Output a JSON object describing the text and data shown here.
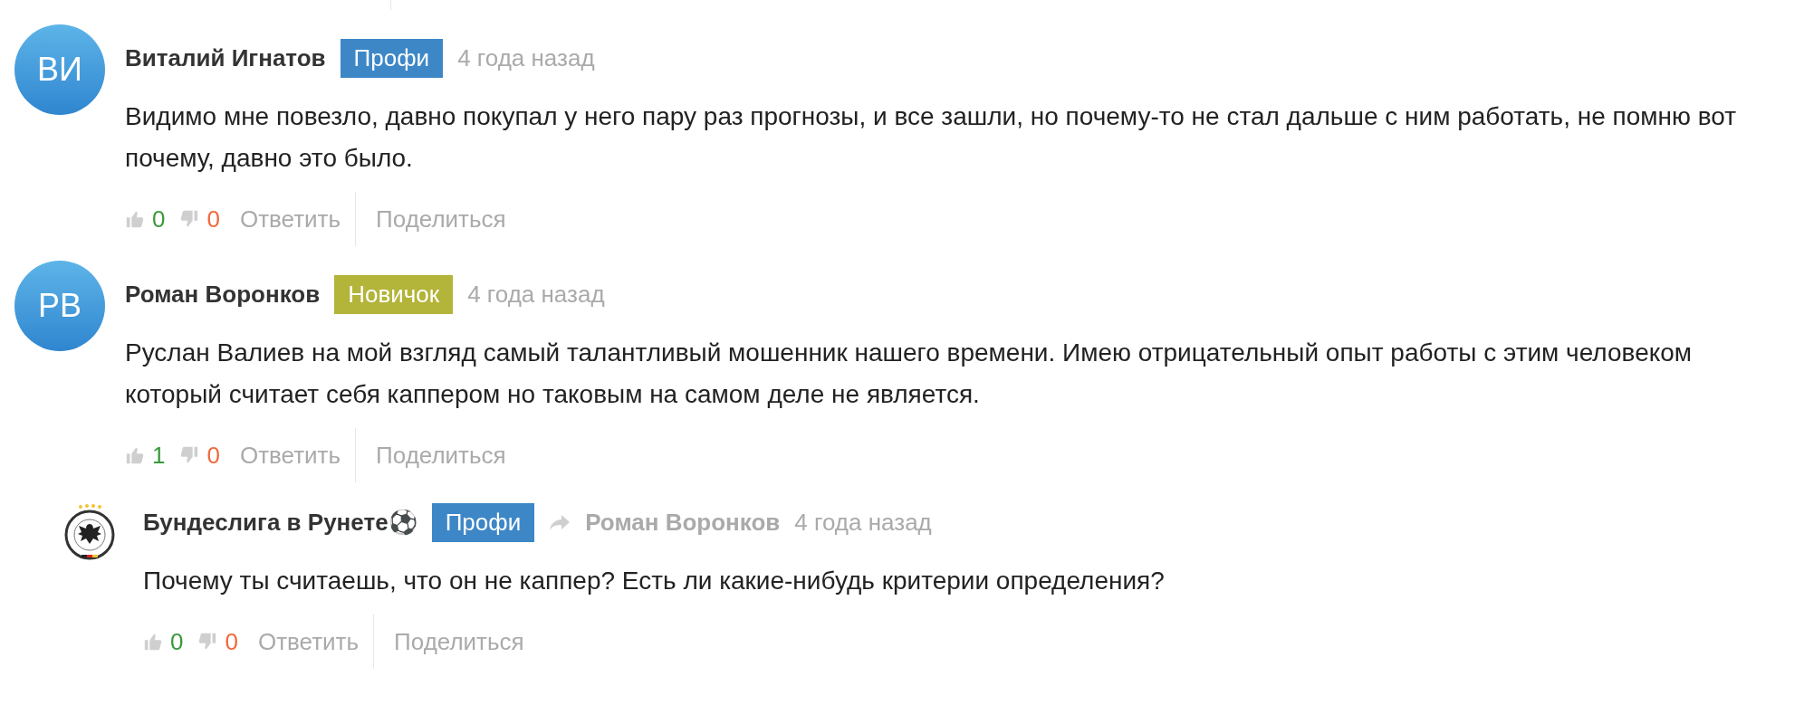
{
  "comments": [
    {
      "avatar": {
        "kind": "initials",
        "text": "ВИ"
      },
      "author": "Виталий Игнатов",
      "badge": {
        "text": "Профи",
        "color": "#3d87c7"
      },
      "time": "4 года назад",
      "text": "Видимо мне повезло, давно покупал у него пару раз прогнозы, и все зашли, но почему-то не стал дальше с ним работать, не помню вот почему, давно это было.",
      "likes": "0",
      "dislikes": "0",
      "reply_label": "Ответить",
      "share_label": "Поделиться"
    },
    {
      "avatar": {
        "kind": "initials",
        "text": "РВ"
      },
      "author": "Роман Воронков",
      "badge": {
        "text": "Новичок",
        "color": "#b3b43a"
      },
      "time": "4 года назад",
      "text": "Руслан Валиев на мой взгляд самый талантливый мошенник нашего времени. Имею отрицательный опыт работы с этим человеком который считает себя каппером но таковым на самом деле не является.",
      "likes": "1",
      "dislikes": "0",
      "reply_label": "Ответить",
      "share_label": "Поделиться",
      "children": [
        {
          "avatar": {
            "kind": "emblem"
          },
          "author": "Бундеслига в Рунете⚽",
          "badge": {
            "text": "Профи",
            "color": "#3d87c7"
          },
          "reply_to": "Роман Воронков",
          "time": "4 года назад",
          "text": "Почему ты считаешь, что он не каппер? Есть ли какие-нибудь критерии определения?",
          "likes": "0",
          "dislikes": "0",
          "reply_label": "Ответить",
          "share_label": "Поделиться"
        }
      ]
    }
  ]
}
